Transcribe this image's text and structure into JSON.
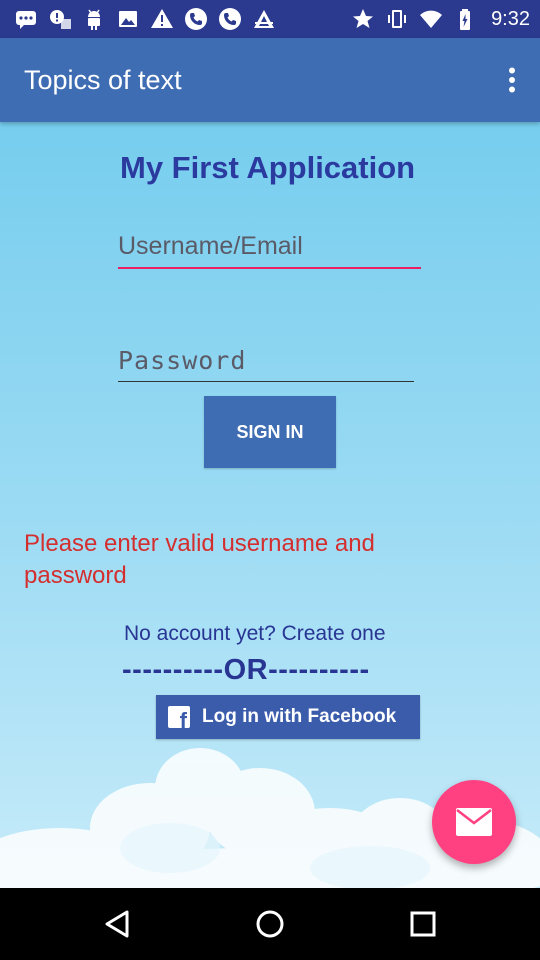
{
  "status_bar": {
    "time": "9:32",
    "left_icons": [
      "message-icon",
      "notification-icon",
      "android-icon",
      "image-icon",
      "warning-icon",
      "phone-icon",
      "phone-icon",
      "triangle-app-icon"
    ],
    "right_icons": [
      "star-icon",
      "vibrate-icon",
      "wifi-icon",
      "battery-icon"
    ]
  },
  "app_bar": {
    "title": "Topics of text"
  },
  "login": {
    "heading": "My First Application",
    "username_placeholder": "Username/Email",
    "password_placeholder": "Password",
    "signin_label": "SIGN IN",
    "error_message": "Please enter valid username and password",
    "create_account": "No account yet? Create one",
    "or_divider": "----------OR----------",
    "facebook_label": "Log in with Facebook"
  },
  "colors": {
    "status_bar": "#2b3a8f",
    "app_bar": "#3f6db3",
    "accent": "#ff4081",
    "error": "#d32f2f",
    "heading": "#2b3a9f"
  }
}
